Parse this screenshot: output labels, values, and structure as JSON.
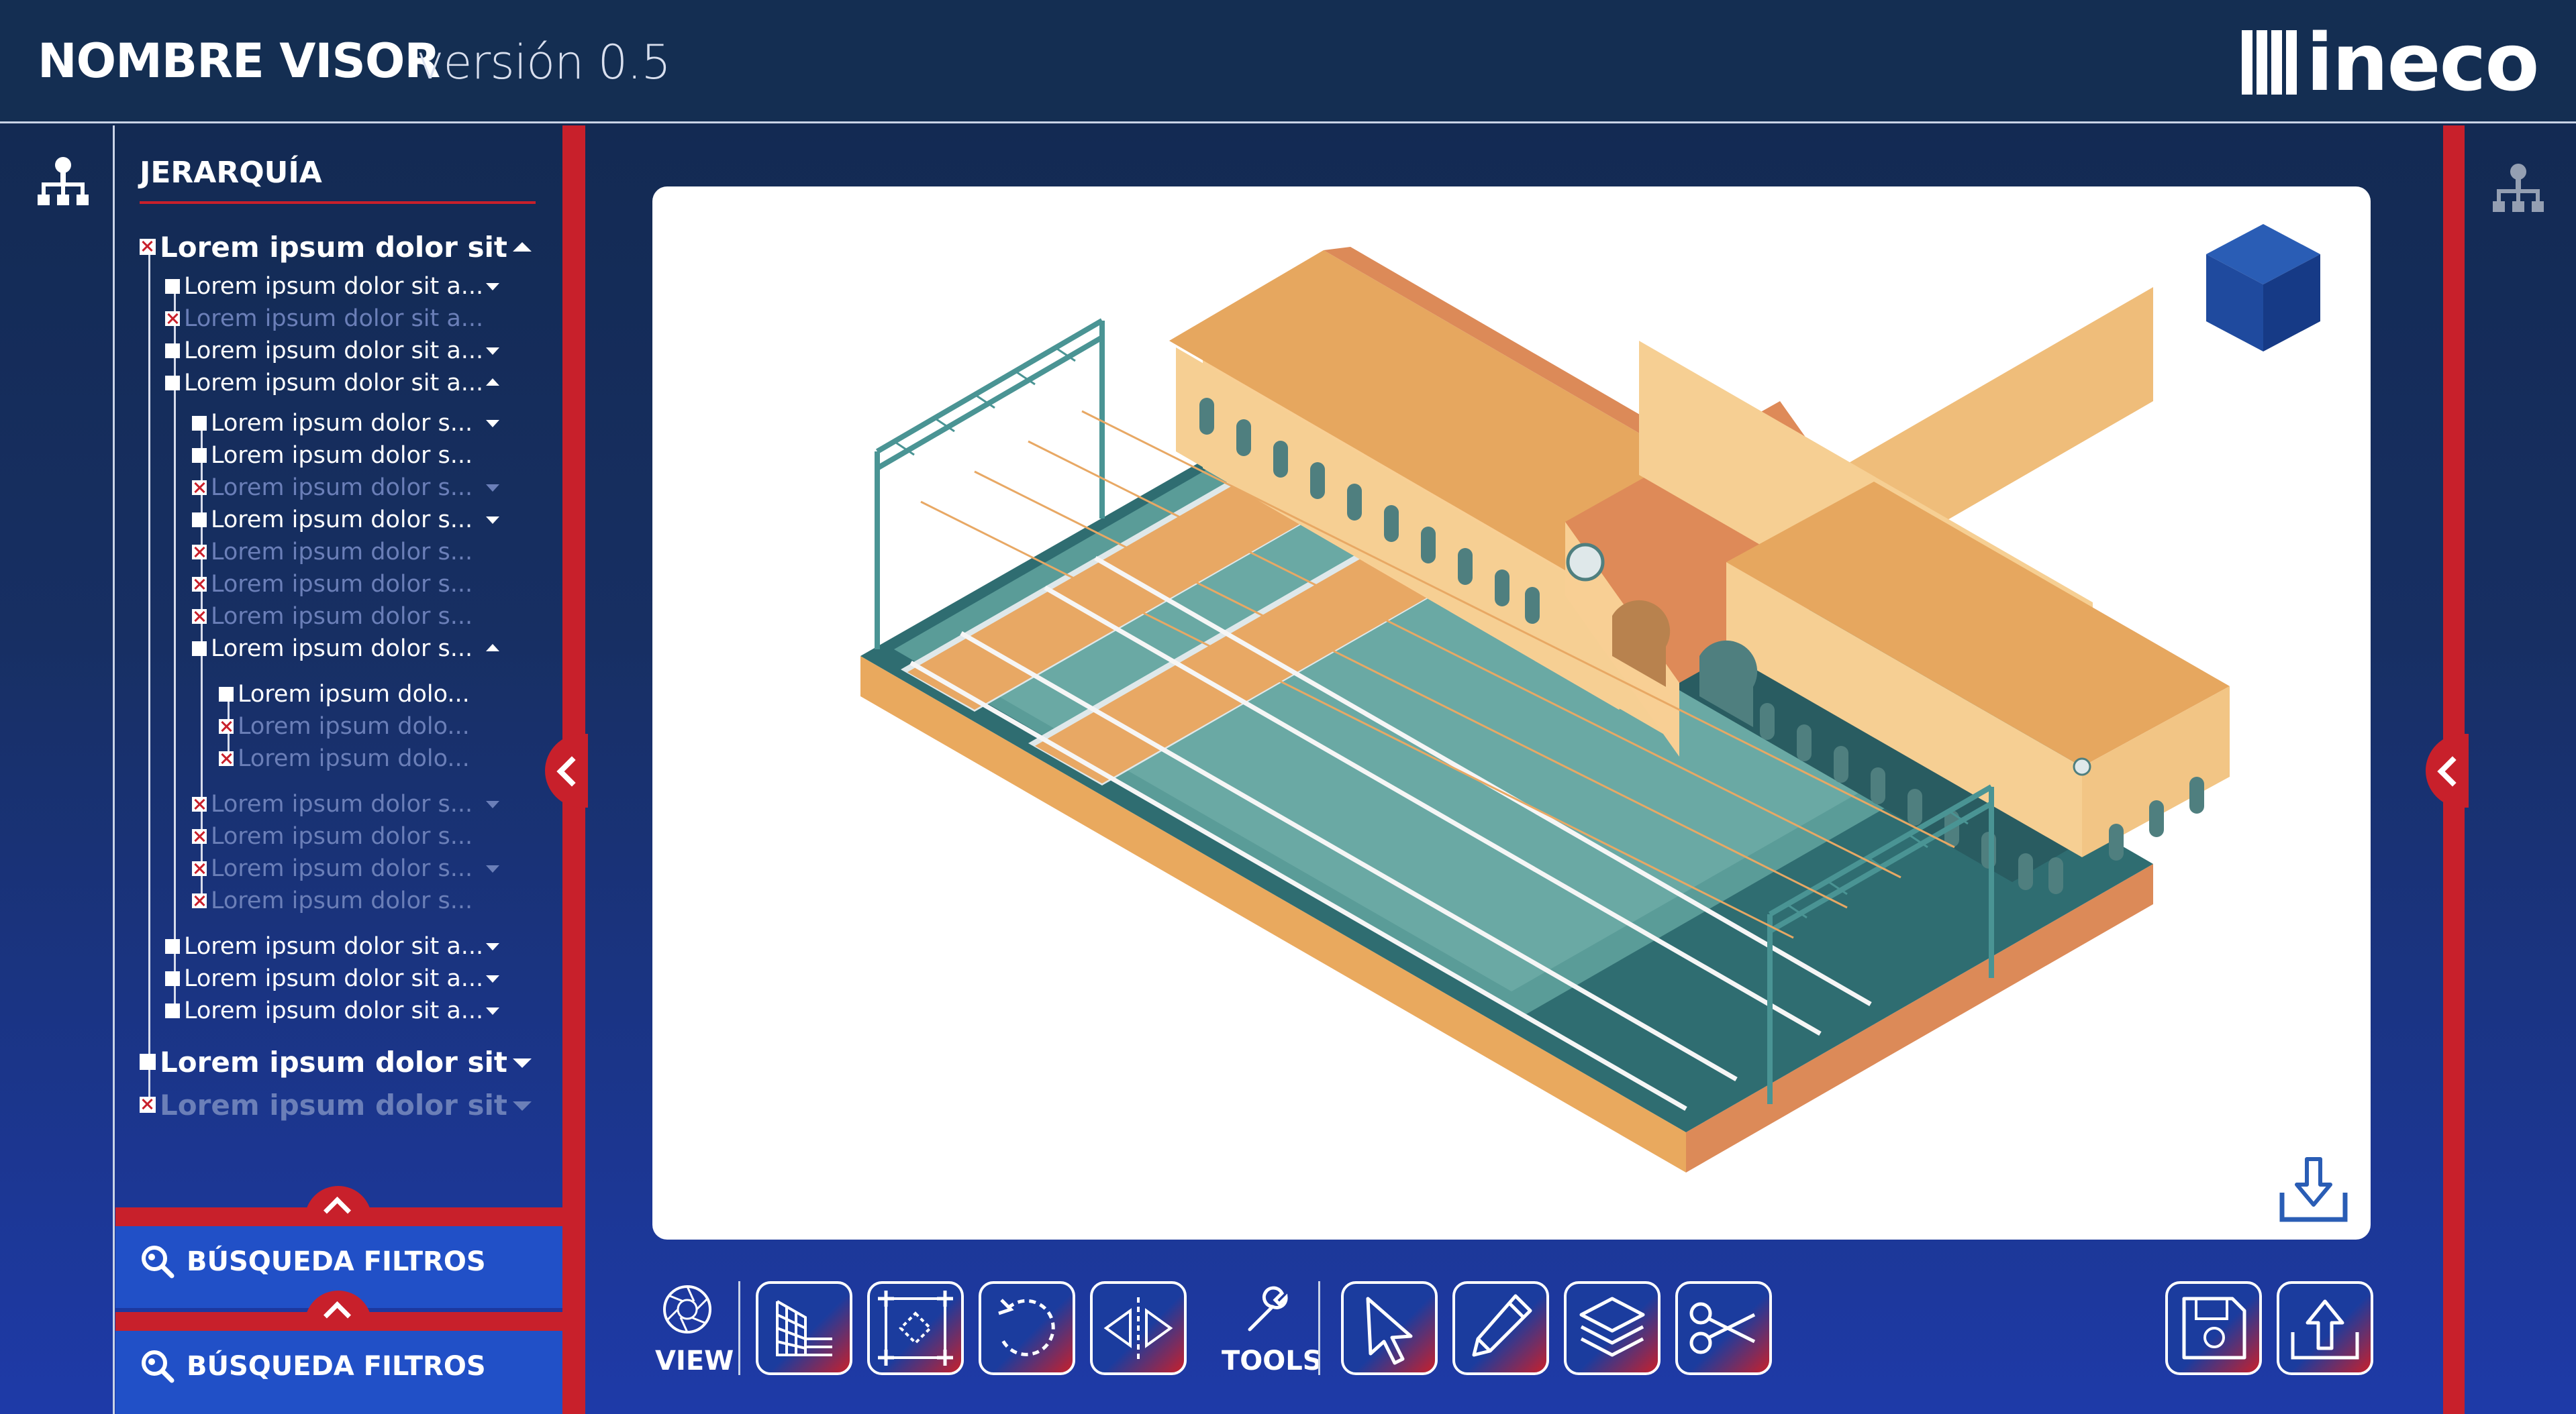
{
  "header": {
    "title": "NOMBRE VISOR",
    "version": "versión 0.5",
    "logo_text": "ineco"
  },
  "hierarchy": {
    "title": "JERARQUÍA",
    "items": [
      {
        "label": "Lorem ipsum dolor sit",
        "level": 0,
        "checked": false,
        "dim": false,
        "caret": "up"
      },
      {
        "label": "Lorem ipsum dolor sit a...",
        "level": 1,
        "checked": true,
        "dim": false,
        "caret": "down"
      },
      {
        "label": "Lorem ipsum dolor sit a...",
        "level": 1,
        "checked": false,
        "dim": true,
        "caret": ""
      },
      {
        "label": "Lorem ipsum dolor sit a...",
        "level": 1,
        "checked": true,
        "dim": false,
        "caret": "down"
      },
      {
        "label": "Lorem ipsum dolor sit a...",
        "level": 1,
        "checked": true,
        "dim": false,
        "caret": "up"
      },
      {
        "label": "Lorem ipsum dolor s...",
        "level": 2,
        "checked": true,
        "dim": false,
        "caret": "down"
      },
      {
        "label": "Lorem ipsum dolor s...",
        "level": 2,
        "checked": true,
        "dim": false,
        "caret": ""
      },
      {
        "label": "Lorem ipsum dolor s...",
        "level": 2,
        "checked": false,
        "dim": true,
        "caret": "down"
      },
      {
        "label": "Lorem ipsum dolor s...",
        "level": 2,
        "checked": true,
        "dim": false,
        "caret": "down"
      },
      {
        "label": "Lorem ipsum dolor s...",
        "level": 2,
        "checked": false,
        "dim": true,
        "caret": ""
      },
      {
        "label": "Lorem ipsum dolor s...",
        "level": 2,
        "checked": false,
        "dim": true,
        "caret": ""
      },
      {
        "label": "Lorem ipsum dolor s...",
        "level": 2,
        "checked": false,
        "dim": true,
        "caret": ""
      },
      {
        "label": "Lorem ipsum dolor s...",
        "level": 2,
        "checked": true,
        "dim": false,
        "caret": "up"
      },
      {
        "label": "Lorem ipsum dolo...",
        "level": 3,
        "checked": true,
        "dim": false,
        "caret": ""
      },
      {
        "label": "Lorem ipsum dolo...",
        "level": 3,
        "checked": false,
        "dim": true,
        "caret": ""
      },
      {
        "label": "Lorem ipsum dolo...",
        "level": 3,
        "checked": false,
        "dim": true,
        "caret": ""
      },
      {
        "label": "Lorem ipsum dolor s...",
        "level": 2,
        "checked": false,
        "dim": true,
        "caret": "down"
      },
      {
        "label": "Lorem ipsum dolor s...",
        "level": 2,
        "checked": false,
        "dim": true,
        "caret": ""
      },
      {
        "label": "Lorem ipsum dolor s...",
        "level": 2,
        "checked": false,
        "dim": true,
        "caret": "down"
      },
      {
        "label": "Lorem ipsum dolor s...",
        "level": 2,
        "checked": false,
        "dim": true,
        "caret": ""
      },
      {
        "label": "Lorem ipsum dolor sit a...",
        "level": 1,
        "checked": true,
        "dim": false,
        "caret": "down"
      },
      {
        "label": "Lorem ipsum dolor sit a...",
        "level": 1,
        "checked": true,
        "dim": false,
        "caret": "down"
      },
      {
        "label": "Lorem ipsum dolor sit a...",
        "level": 1,
        "checked": true,
        "dim": false,
        "caret": "down"
      },
      {
        "label": "Lorem ipsum dolor sit",
        "level": 0,
        "checked": true,
        "dim": false,
        "caret": "down"
      },
      {
        "label": "Lorem ipsum dolor sit",
        "level": 0,
        "checked": false,
        "dim": true,
        "caret": "down"
      }
    ]
  },
  "search": {
    "filters_1": "BÚSQUEDA FILTROS",
    "filters_2": "BÚSQUEDA FILTROS"
  },
  "toolbar": {
    "view_label": "VIEW",
    "tools_label": "TOOLS"
  },
  "colors": {
    "accent_red": "#c8202b",
    "navy": "#142e52",
    "blue": "#2150c7"
  }
}
